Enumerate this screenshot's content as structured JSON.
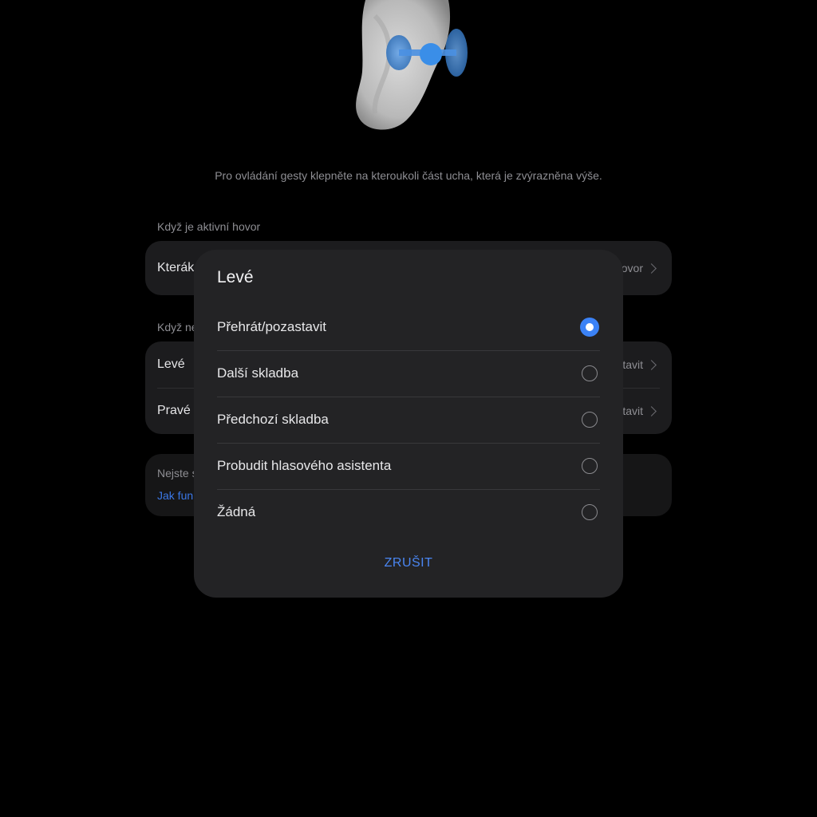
{
  "background": {
    "hint_text": "Pro ovládání gesty klepněte na kteroukoli část ucha, která je zvýrazněna výše.",
    "section_call": {
      "label": "Když je aktivní hovor",
      "rows": [
        {
          "label": "Kterák",
          "value": "hovor"
        }
      ]
    },
    "section_no_call": {
      "label": "Když ne",
      "rows": [
        {
          "label": "Levé",
          "value": "tavit"
        },
        {
          "label": "Pravé",
          "value": "tavit"
        }
      ]
    },
    "info": {
      "text": "Nejste s",
      "link": "Jak fun"
    }
  },
  "dialog": {
    "title": "Levé",
    "options": [
      {
        "label": "Přehrát/pozastavit",
        "checked": true
      },
      {
        "label": "Další skladba",
        "checked": false
      },
      {
        "label": "Předchozí skladba",
        "checked": false
      },
      {
        "label": "Probudit hlasového asistenta",
        "checked": false
      },
      {
        "label": "Žádná",
        "checked": false
      }
    ],
    "cancel_label": "ZRUŠIT"
  },
  "colors": {
    "accent": "#3b82f6",
    "link": "#4a86f2",
    "dialog_bg": "#232325",
    "card_bg": "#1c1c1e",
    "page_bg": "#000000"
  }
}
